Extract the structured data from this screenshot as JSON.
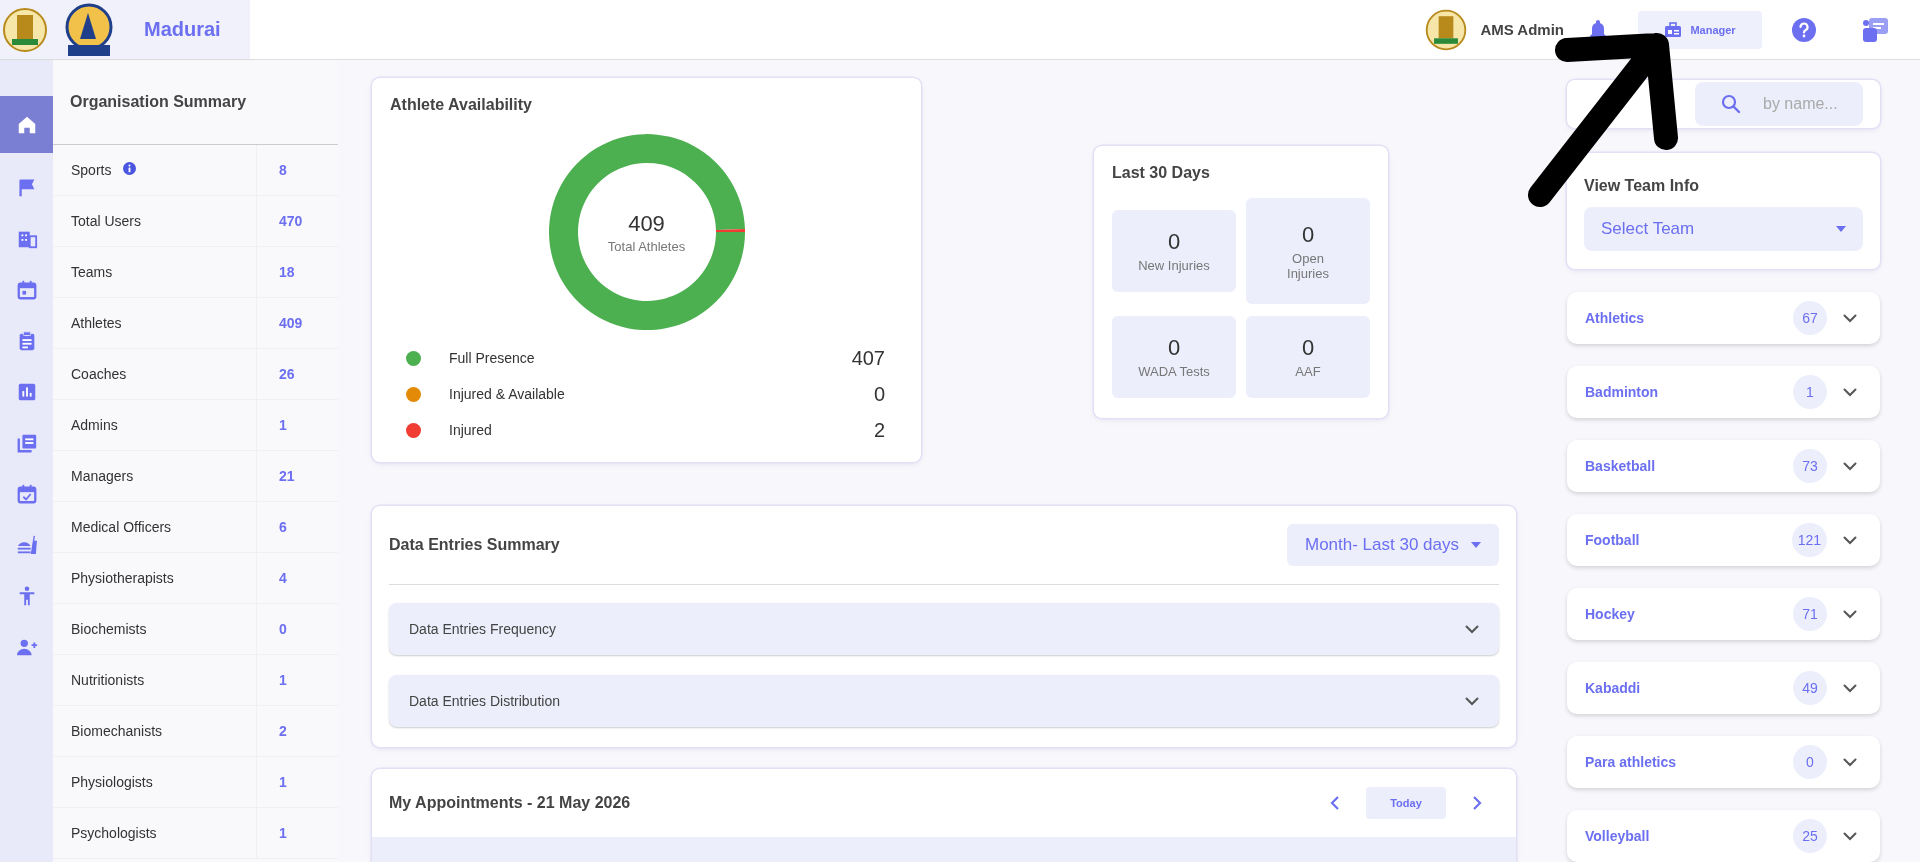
{
  "header": {
    "org_name": "Madurai",
    "user_name": "AMS Admin",
    "role_button": "Manager"
  },
  "nav_items": [
    {
      "kind": "home",
      "selected": true
    },
    {
      "kind": "flag",
      "selected": false
    },
    {
      "kind": "building",
      "selected": false
    },
    {
      "kind": "calendar",
      "selected": false
    },
    {
      "kind": "clipboard",
      "selected": false
    },
    {
      "kind": "chart",
      "selected": false
    },
    {
      "kind": "list",
      "selected": false
    },
    {
      "kind": "calendar-check",
      "selected": false
    },
    {
      "kind": "food",
      "selected": false
    },
    {
      "kind": "person",
      "selected": false
    },
    {
      "kind": "person-add",
      "selected": false
    }
  ],
  "organisation_summary": {
    "title": "Organisation Summary",
    "rows": [
      {
        "label": "Sports",
        "value": "8",
        "info": true
      },
      {
        "label": "Total Users",
        "value": "470",
        "info": false
      },
      {
        "label": "Teams",
        "value": "18",
        "info": false
      },
      {
        "label": "Athletes",
        "value": "409",
        "info": false
      },
      {
        "label": "Coaches",
        "value": "26",
        "info": false
      },
      {
        "label": "Admins",
        "value": "1",
        "info": false
      },
      {
        "label": "Managers",
        "value": "21",
        "info": false
      },
      {
        "label": "Medical Officers",
        "value": "6",
        "info": false
      },
      {
        "label": "Physiotherapists",
        "value": "4",
        "info": false
      },
      {
        "label": "Biochemists",
        "value": "0",
        "info": false
      },
      {
        "label": "Nutritionists",
        "value": "1",
        "info": false
      },
      {
        "label": "Biomechanists",
        "value": "2",
        "info": false
      },
      {
        "label": "Physiologists",
        "value": "1",
        "info": false
      },
      {
        "label": "Psychologists",
        "value": "1",
        "info": false
      }
    ]
  },
  "athlete_availability": {
    "title": "Athlete Availability",
    "total": "409",
    "total_label": "Total Athletes",
    "chart_data": {
      "type": "donut",
      "categories": [
        "Full Presence",
        "Injured & Available",
        "Injured"
      ],
      "values": [
        99.51,
        0,
        0.49
      ]
    },
    "legend": [
      {
        "value": "407",
        "color": "#4caf50"
      },
      {
        "value": "0",
        "color": "#e38a06"
      },
      {
        "value": "2",
        "color": "#f03c33"
      }
    ]
  },
  "last_30_days": {
    "title": "Last 30 Days",
    "stats": [
      {
        "value": "0",
        "label": "New Injuries"
      },
      {
        "value": "0",
        "label": "Open Injuries"
      },
      {
        "value": "0",
        "label": "WADA Tests"
      },
      {
        "value": "0",
        "label": "AAF"
      }
    ]
  },
  "data_entries_summary": {
    "title": "Data Entries Summary",
    "period_dropdown": "Month- Last 30 days",
    "sections": [
      {
        "label": "Data Entries Frequency",
        "expanded": false
      },
      {
        "label": "Data Entries Distribution",
        "expanded": false
      }
    ]
  },
  "appointments": {
    "title": "My Appointments - 21 May 2026",
    "today_button": "Today"
  },
  "team_search": {
    "placeholder": "by name..."
  },
  "view_team_info": {
    "title": "View Team Info",
    "select_placeholder": "Select Team"
  },
  "teams": [
    {
      "name": "Athletics",
      "count": "67",
      "expanded": false
    },
    {
      "name": "Badminton",
      "count": "1",
      "expanded": false
    },
    {
      "name": "Basketball",
      "count": "73",
      "expanded": false
    },
    {
      "name": "Football",
      "count": "121",
      "expanded": false
    },
    {
      "name": "Hockey",
      "count": "71",
      "expanded": false
    },
    {
      "name": "Kabaddi",
      "count": "49",
      "expanded": false
    },
    {
      "name": "Para athletics",
      "count": "0",
      "expanded": false
    },
    {
      "name": "Volleyball",
      "count": "25",
      "expanded": false
    }
  ]
}
